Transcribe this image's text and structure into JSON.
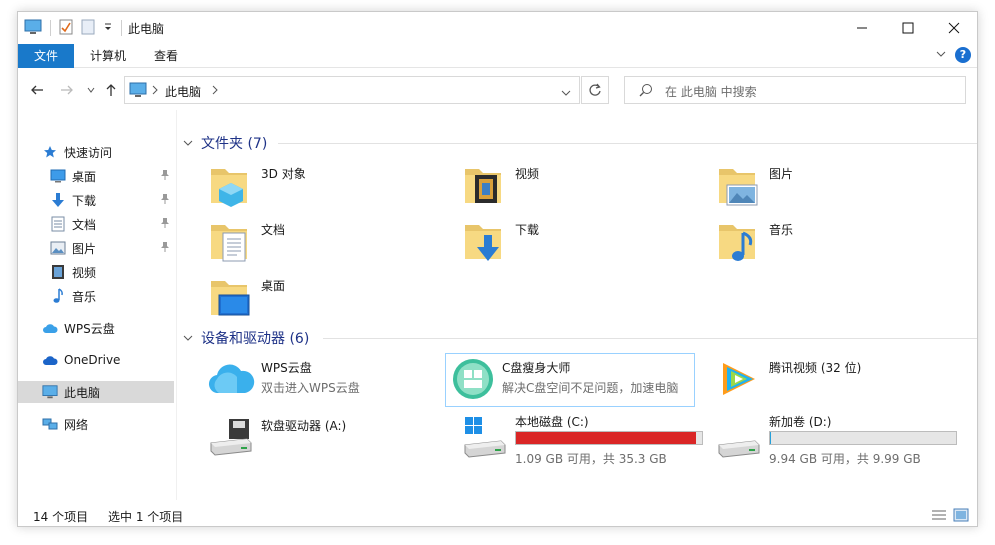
{
  "window": {
    "title": "此电脑"
  },
  "ribbon": {
    "tabs": [
      "文件",
      "计算机",
      "查看"
    ],
    "help_label": "?"
  },
  "address": {
    "path_root": "此电脑"
  },
  "search": {
    "placeholder": "在 此电脑 中搜索"
  },
  "nav": {
    "quick_access": "快速访问",
    "items": [
      {
        "label": "桌面",
        "icon": "desktop-icon",
        "pinned": true
      },
      {
        "label": "下载",
        "icon": "download-icon",
        "pinned": true
      },
      {
        "label": "文档",
        "icon": "document-icon",
        "pinned": true
      },
      {
        "label": "图片",
        "icon": "picture-icon",
        "pinned": true
      },
      {
        "label": "视频",
        "icon": "video-icon",
        "pinned": false
      },
      {
        "label": "音乐",
        "icon": "music-icon",
        "pinned": false
      }
    ],
    "wps_cloud": "WPS云盘",
    "onedrive": "OneDrive",
    "this_pc": "此电脑",
    "network": "网络"
  },
  "folders": {
    "heading": "文件夹 (7)",
    "items": [
      {
        "name": "3D 对象",
        "icon": "3d-objects-icon"
      },
      {
        "name": "视频",
        "icon": "video-folder-icon"
      },
      {
        "name": "图片",
        "icon": "pictures-folder-icon"
      },
      {
        "name": "文档",
        "icon": "documents-folder-icon"
      },
      {
        "name": "下载",
        "icon": "downloads-folder-icon"
      },
      {
        "name": "音乐",
        "icon": "music-folder-icon"
      },
      {
        "name": "桌面",
        "icon": "desktop-folder-icon"
      }
    ]
  },
  "devices": {
    "heading": "设备和驱动器 (6)",
    "wps": {
      "name": "WPS云盘",
      "desc": "双击进入WPS云盘"
    },
    "cleaner": {
      "name": "C盘瘦身大师",
      "desc": "解决C盘空间不足问题，加速电脑"
    },
    "tencent": {
      "name": "腾讯视频 (32 位)"
    },
    "floppy": {
      "name": "软盘驱动器 (A:)"
    },
    "drive_c": {
      "name": "本地磁盘 (C:)",
      "free": "1.09 GB 可用，共 35.3 GB",
      "used_fraction": 0.97,
      "bar_color": "#da2626"
    },
    "drive_d": {
      "name": "新加卷 (D:)",
      "free": "9.94 GB 可用，共 9.99 GB",
      "used_fraction": 0.005,
      "bar_color": "#26a0da"
    }
  },
  "status": {
    "count": "14 个项目",
    "selected": "选中 1 个项目"
  },
  "colors": {
    "accent": "#1979ca",
    "group_heading": "#1e3287",
    "selected_nav": "#d9d9d9"
  }
}
